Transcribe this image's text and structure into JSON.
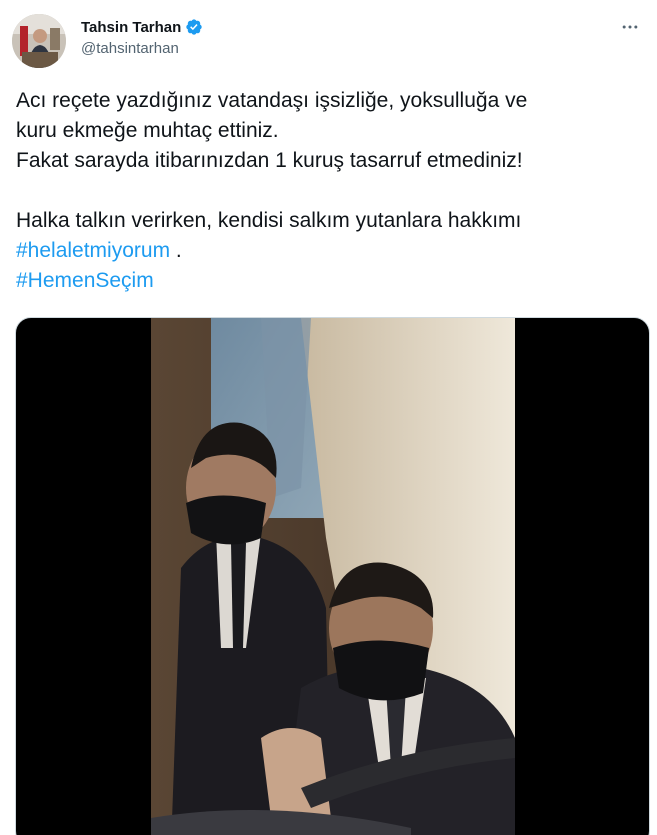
{
  "author": {
    "display_name": "Tahsin Tarhan",
    "handle": "@tahsintarhan",
    "avatar_icon": "avatar-photo",
    "verified_icon": "verified-badge-icon"
  },
  "more_icon": "more-options-icon",
  "tweet": {
    "line1": "Acı reçete yazdığınız vatandaşı işsizliğe, yoksulluğa ve",
    "line2": "kuru ekmeğe muhtaç ettiniz.",
    "line3": "Fakat sarayda itibarınızdan 1 kuruş tasarruf etmediniz!",
    "line4": "Halka talkın verirken, kendisi salkım yutanlara hakkımı",
    "hashtag1": "#helaletmiyorum",
    "line5_suffix": " .",
    "hashtag2": "#HemenSeçim"
  },
  "colors": {
    "link": "#1d9bf0",
    "verified": "#1d9bf0",
    "text": "#0f1419",
    "secondary": "#536471"
  }
}
